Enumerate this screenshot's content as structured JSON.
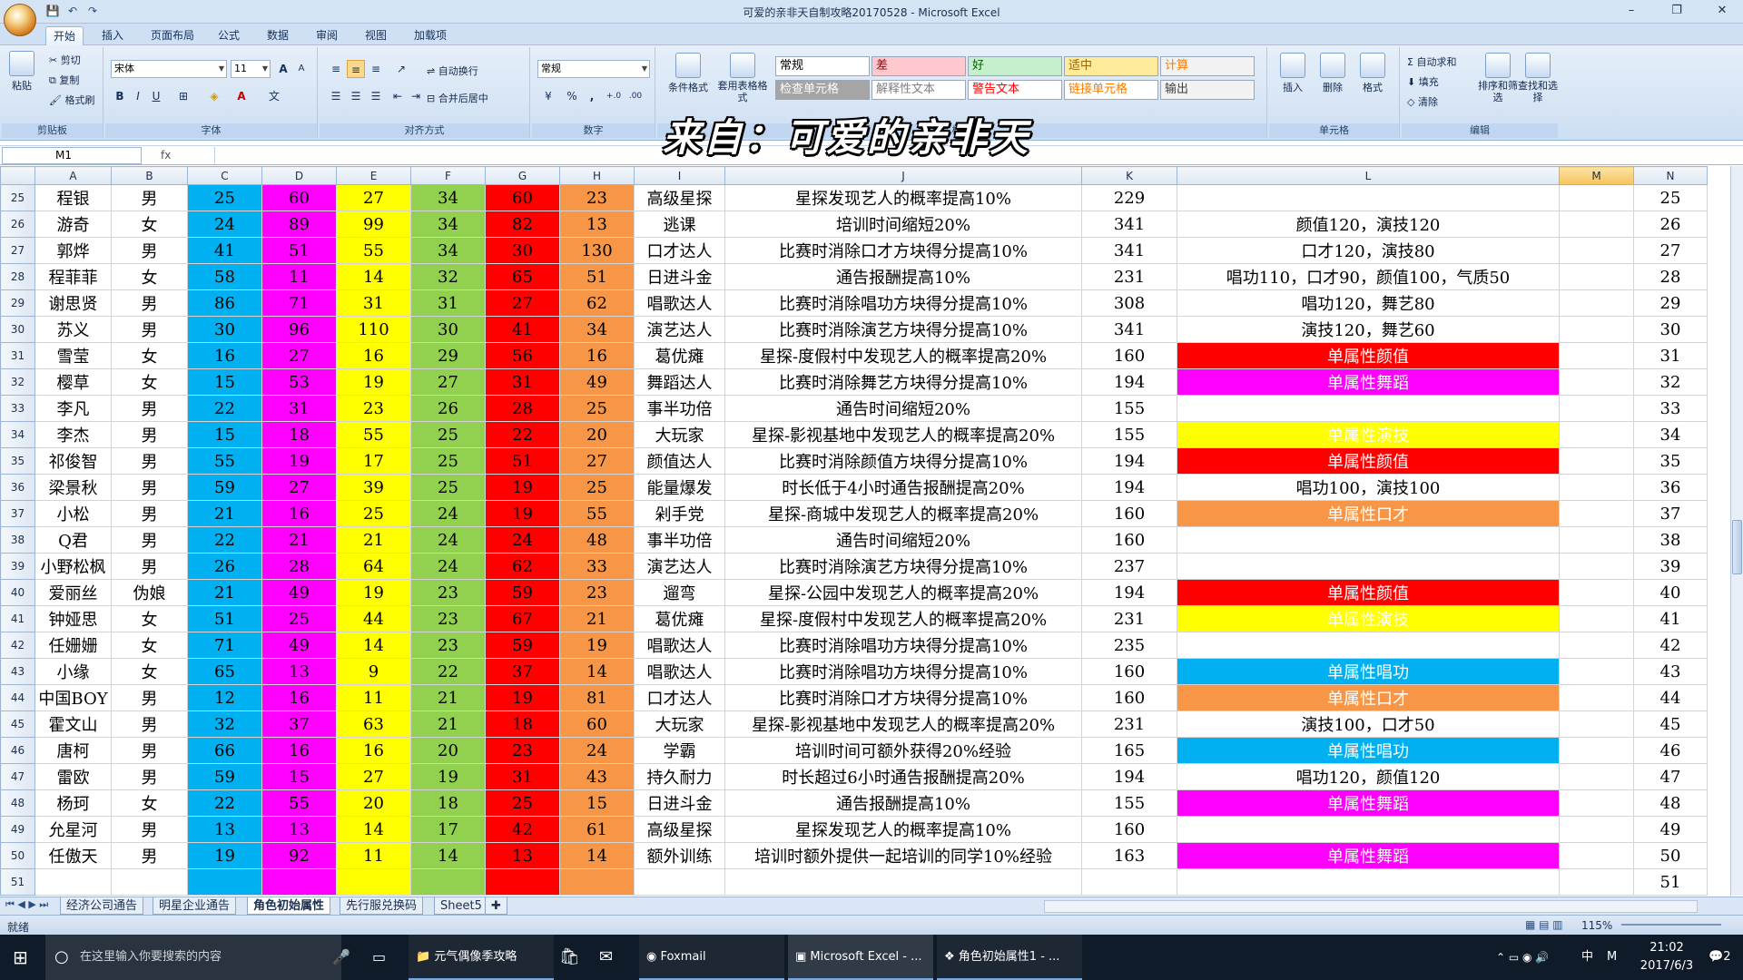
{
  "window": {
    "title": "可爱的亲非天自制攻略20170528 - Microsoft Excel",
    "minimize": "–",
    "restore": "❐",
    "close": "✕"
  },
  "qat": {
    "save": "💾",
    "undo": "↶",
    "redo": "↷"
  },
  "tabs": [
    "开始",
    "插入",
    "页面布局",
    "公式",
    "数据",
    "审阅",
    "视图",
    "加载项"
  ],
  "ribbon": {
    "clipboard": {
      "label": "剪贴板",
      "paste": "粘贴",
      "cut": "剪切",
      "copy": "复制",
      "format_painter": "格式刷"
    },
    "font": {
      "label": "字体",
      "name": "宋体",
      "size": "11",
      "bold": "B",
      "italic": "I",
      "underline": "U",
      "grow": "A",
      "shrink": "A"
    },
    "alignment": {
      "label": "对齐方式",
      "wrap": "自动换行",
      "merge": "合并后居中"
    },
    "number": {
      "label": "数字",
      "format": "常规",
      "percent": "%",
      "comma": ",",
      "inc": "+.0",
      "dec": ".00"
    },
    "styles": {
      "label": "样式",
      "cond_format": "条件格式",
      "table_format": "套用表格格式",
      "cells": [
        {
          "text": "常规",
          "bg": "#ffffff",
          "fg": "#000000"
        },
        {
          "text": "差",
          "bg": "#ffc7ce",
          "fg": "#9c0006"
        },
        {
          "text": "好",
          "bg": "#c6efce",
          "fg": "#006100"
        },
        {
          "text": "适中",
          "bg": "#ffeb9c",
          "fg": "#9c6500"
        },
        {
          "text": "计算",
          "bg": "#f2f2f2",
          "fg": "#fa7d00"
        },
        {
          "text": "检查单元格",
          "bg": "#a5a5a5",
          "fg": "#ffffff"
        },
        {
          "text": "解释性文本",
          "bg": "#ffffff",
          "fg": "#7f7f7f"
        },
        {
          "text": "警告文本",
          "bg": "#ffffff",
          "fg": "#ff0000"
        },
        {
          "text": "链接单元格",
          "bg": "#ffffff",
          "fg": "#fa7d00"
        },
        {
          "text": "输出",
          "bg": "#f2f2f2",
          "fg": "#3f3f3f"
        }
      ]
    },
    "cells": {
      "label": "单元格",
      "insert": "插入",
      "delete": "删除",
      "format": "格式"
    },
    "editing": {
      "label": "编辑",
      "autosum": "自动求和",
      "fill": "填充",
      "clear": "清除",
      "sort": "排序和筛选",
      "find": "查找和选择"
    }
  },
  "watermark": "来自：可爱的亲非天",
  "formula_bar": {
    "name_box": "M1",
    "fx": "fx",
    "value": ""
  },
  "columns": [
    "A",
    "B",
    "C",
    "D",
    "E",
    "F",
    "G",
    "H",
    "I",
    "J",
    "K",
    "L",
    "M",
    "N"
  ],
  "rows": [
    {
      "n": "25",
      "a": "程银",
      "b": "男",
      "c": "25",
      "d": "60",
      "e": "27",
      "f": "34",
      "g": "60",
      "h": "23",
      "i": "高级星探",
      "j": "星探发现艺人的概率提高10%",
      "k": "229",
      "l": "",
      "lbg": ""
    },
    {
      "n": "26",
      "a": "游奇",
      "b": "女",
      "c": "24",
      "d": "89",
      "e": "99",
      "f": "34",
      "g": "82",
      "h": "13",
      "i": "逃课",
      "j": "培训时间缩短20%",
      "k": "341",
      "l": "颜值120，演技120",
      "lbg": ""
    },
    {
      "n": "27",
      "a": "郭烨",
      "b": "男",
      "c": "41",
      "d": "51",
      "e": "55",
      "f": "34",
      "g": "30",
      "h": "130",
      "i": "口才达人",
      "j": "比赛时消除口才方块得分提高10%",
      "k": "341",
      "l": "口才120，演技80",
      "lbg": ""
    },
    {
      "n": "28",
      "a": "程菲菲",
      "b": "女",
      "c": "58",
      "d": "11",
      "e": "14",
      "f": "32",
      "g": "65",
      "h": "51",
      "i": "日进斗金",
      "j": "通告报酬提高10%",
      "k": "231",
      "l": "唱功110，口才90，颜值100，气质50",
      "lbg": ""
    },
    {
      "n": "29",
      "a": "谢思贤",
      "b": "男",
      "c": "86",
      "d": "71",
      "e": "31",
      "f": "31",
      "g": "27",
      "h": "62",
      "i": "唱歌达人",
      "j": "比赛时消除唱功方块得分提高10%",
      "k": "308",
      "l": "唱功120，舞艺80",
      "lbg": ""
    },
    {
      "n": "30",
      "a": "苏义",
      "b": "男",
      "c": "30",
      "d": "96",
      "e": "110",
      "f": "30",
      "g": "41",
      "h": "34",
      "i": "演艺达人",
      "j": "比赛时消除演艺方块得分提高10%",
      "k": "341",
      "l": "演技120，舞艺60",
      "lbg": ""
    },
    {
      "n": "31",
      "a": "雪莹",
      "b": "女",
      "c": "16",
      "d": "27",
      "e": "16",
      "f": "29",
      "g": "56",
      "h": "16",
      "i": "葛优瘫",
      "j": "星探-度假村中发现艺人的概率提高20%",
      "k": "160",
      "l": "单属性颜值",
      "lbg": "#ff0000"
    },
    {
      "n": "32",
      "a": "樱草",
      "b": "女",
      "c": "15",
      "d": "53",
      "e": "19",
      "f": "27",
      "g": "31",
      "h": "49",
      "i": "舞蹈达人",
      "j": "比赛时消除舞艺方块得分提高10%",
      "k": "194",
      "l": "单属性舞蹈",
      "lbg": "#ff00ff"
    },
    {
      "n": "33",
      "a": "李凡",
      "b": "男",
      "c": "22",
      "d": "31",
      "e": "23",
      "f": "26",
      "g": "28",
      "h": "25",
      "i": "事半功倍",
      "j": "通告时间缩短20%",
      "k": "155",
      "l": "",
      "lbg": ""
    },
    {
      "n": "34",
      "a": "李杰",
      "b": "男",
      "c": "15",
      "d": "18",
      "e": "55",
      "f": "25",
      "g": "22",
      "h": "20",
      "i": "大玩家",
      "j": "星探-影视基地中发现艺人的概率提高20%",
      "k": "155",
      "l": "单属性演技",
      "lbg": "#ffff00"
    },
    {
      "n": "35",
      "a": "祁俊智",
      "b": "男",
      "c": "55",
      "d": "19",
      "e": "17",
      "f": "25",
      "g": "51",
      "h": "27",
      "i": "颜值达人",
      "j": "比赛时消除颜值方块得分提高10%",
      "k": "194",
      "l": "单属性颜值",
      "lbg": "#ff0000"
    },
    {
      "n": "36",
      "a": "梁景秋",
      "b": "男",
      "c": "59",
      "d": "27",
      "e": "39",
      "f": "25",
      "g": "19",
      "h": "25",
      "i": "能量爆发",
      "j": "时长低于4小时通告报酬提高20%",
      "k": "194",
      "l": "唱功100，演技100",
      "lbg": ""
    },
    {
      "n": "37",
      "a": "小松",
      "b": "男",
      "c": "21",
      "d": "16",
      "e": "25",
      "f": "24",
      "g": "19",
      "h": "55",
      "i": "剁手党",
      "j": "星探-商城中发现艺人的概率提高20%",
      "k": "160",
      "l": "单属性口才",
      "lbg": "#f79646"
    },
    {
      "n": "38",
      "a": "Q君",
      "b": "男",
      "c": "22",
      "d": "21",
      "e": "21",
      "f": "24",
      "g": "24",
      "h": "48",
      "i": "事半功倍",
      "j": "通告时间缩短20%",
      "k": "160",
      "l": "",
      "lbg": ""
    },
    {
      "n": "39",
      "a": "小野松枫",
      "b": "男",
      "c": "26",
      "d": "28",
      "e": "64",
      "f": "24",
      "g": "62",
      "h": "33",
      "i": "演艺达人",
      "j": "比赛时消除演艺方块得分提高10%",
      "k": "237",
      "l": "",
      "lbg": ""
    },
    {
      "n": "40",
      "a": "爱丽丝",
      "b": "伪娘",
      "c": "21",
      "d": "49",
      "e": "19",
      "f": "23",
      "g": "59",
      "h": "23",
      "i": "遛弯",
      "j": "星探-公园中发现艺人的概率提高20%",
      "k": "194",
      "l": "单属性颜值",
      "lbg": "#ff0000"
    },
    {
      "n": "41",
      "a": "钟娅思",
      "b": "女",
      "c": "51",
      "d": "25",
      "e": "44",
      "f": "23",
      "g": "67",
      "h": "21",
      "i": "葛优瘫",
      "j": "星探-度假村中发现艺人的概率提高20%",
      "k": "231",
      "l": "单属性演技",
      "lbg": "#ffff00"
    },
    {
      "n": "42",
      "a": "任姗姗",
      "b": "女",
      "c": "71",
      "d": "49",
      "e": "14",
      "f": "23",
      "g": "59",
      "h": "19",
      "i": "唱歌达人",
      "j": "比赛时消除唱功方块得分提高10%",
      "k": "235",
      "l": "",
      "lbg": ""
    },
    {
      "n": "43",
      "a": "小缘",
      "b": "女",
      "c": "65",
      "d": "13",
      "e": "9",
      "f": "22",
      "g": "37",
      "h": "14",
      "i": "唱歌达人",
      "j": "比赛时消除唱功方块得分提高10%",
      "k": "160",
      "l": "单属性唱功",
      "lbg": "#00b0f0"
    },
    {
      "n": "44",
      "a": "中国BOY",
      "b": "男",
      "c": "12",
      "d": "16",
      "e": "11",
      "f": "21",
      "g": "19",
      "h": "81",
      "i": "口才达人",
      "j": "比赛时消除口才方块得分提高10%",
      "k": "160",
      "l": "单属性口才",
      "lbg": "#f79646"
    },
    {
      "n": "45",
      "a": "霍文山",
      "b": "男",
      "c": "32",
      "d": "37",
      "e": "63",
      "f": "21",
      "g": "18",
      "h": "60",
      "i": "大玩家",
      "j": "星探-影视基地中发现艺人的概率提高20%",
      "k": "231",
      "l": "演技100，口才50",
      "lbg": ""
    },
    {
      "n": "46",
      "a": "唐柯",
      "b": "男",
      "c": "66",
      "d": "16",
      "e": "16",
      "f": "20",
      "g": "23",
      "h": "24",
      "i": "学霸",
      "j": "培训时间可额外获得20%经验",
      "k": "165",
      "l": "单属性唱功",
      "lbg": "#00b0f0"
    },
    {
      "n": "47",
      "a": "雷欧",
      "b": "男",
      "c": "59",
      "d": "15",
      "e": "27",
      "f": "19",
      "g": "31",
      "h": "43",
      "i": "持久耐力",
      "j": "时长超过6小时通告报酬提高20%",
      "k": "194",
      "l": "唱功120，颜值120",
      "lbg": ""
    },
    {
      "n": "48",
      "a": "杨珂",
      "b": "女",
      "c": "22",
      "d": "55",
      "e": "20",
      "f": "18",
      "g": "25",
      "h": "15",
      "i": "日进斗金",
      "j": "通告报酬提高10%",
      "k": "155",
      "l": "单属性舞蹈",
      "lbg": "#ff00ff"
    },
    {
      "n": "49",
      "a": "允星河",
      "b": "男",
      "c": "13",
      "d": "13",
      "e": "14",
      "f": "17",
      "g": "42",
      "h": "61",
      "i": "高级星探",
      "j": "星探发现艺人的概率提高10%",
      "k": "160",
      "l": "",
      "lbg": ""
    },
    {
      "n": "50",
      "a": "任傲天",
      "b": "男",
      "c": "19",
      "d": "92",
      "e": "11",
      "f": "14",
      "g": "13",
      "h": "14",
      "i": "额外训练",
      "j": "培训时额外提供一起培训的同学10%经验",
      "k": "163",
      "l": "单属性舞蹈",
      "lbg": "#ff00ff"
    },
    {
      "n": "51",
      "a": "",
      "b": "",
      "c": "",
      "d": "",
      "e": "",
      "f": "",
      "g": "",
      "h": "",
      "i": "",
      "j": "",
      "k": "",
      "l": "",
      "lbg": ""
    }
  ],
  "sheets": [
    "经济公司通告",
    "明星企业通告",
    "角色初始属性",
    "先行服兑换码",
    "Sheet5"
  ],
  "active_sheet": 2,
  "status": {
    "ready": "就绪",
    "zoom": "115%"
  },
  "taskbar": {
    "search": "在这里输入你要搜索的内容",
    "items": [
      "元气偶像季攻略",
      "Foxmail",
      "Microsoft Excel - ...",
      "角色初始属性1 - ..."
    ],
    "time": "21:02",
    "date": "2017/6/3",
    "ime": "中",
    "ime2": "M",
    "notif": "2"
  }
}
